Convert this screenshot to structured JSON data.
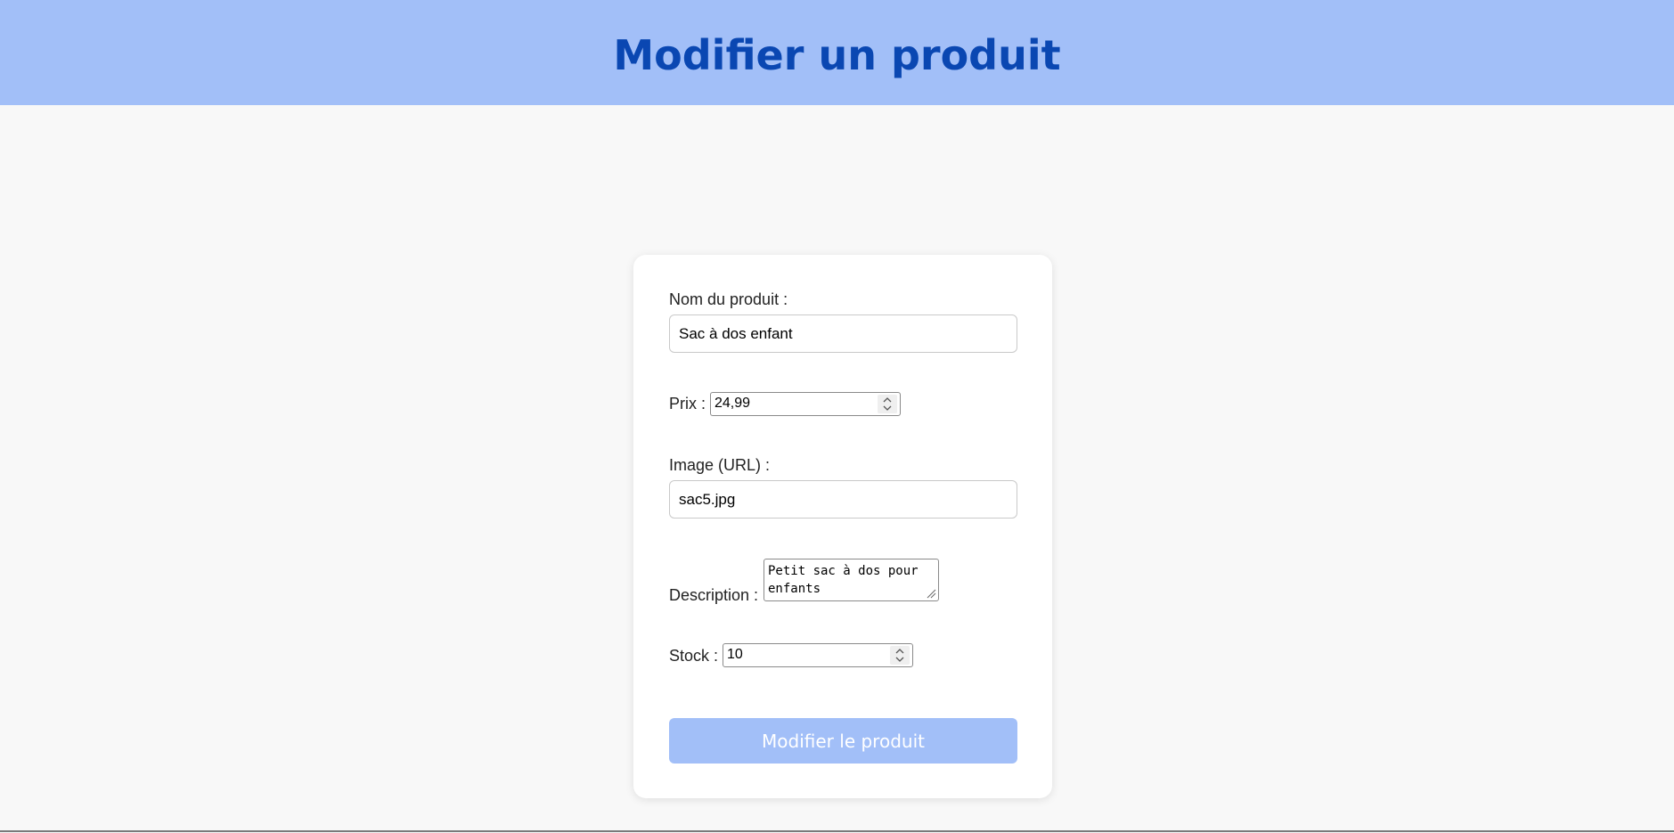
{
  "header": {
    "title": "Modifier un produit"
  },
  "form": {
    "name": {
      "label": "Nom du produit :",
      "value": "Sac à dos enfant"
    },
    "price": {
      "label": "Prix :",
      "value": "24,99"
    },
    "image": {
      "label": "Image (URL) :",
      "value": "sac5.jpg"
    },
    "description": {
      "label": "Description :",
      "line1": "Petit sac à dos pour",
      "line2": "enfants"
    },
    "stock": {
      "label": "Stock :",
      "value": "10"
    },
    "submit_label": "Modifier le produit"
  },
  "colors": {
    "header_bg": "#a2bff8",
    "title": "#0a47b2",
    "button_bg": "#a2bff8"
  }
}
